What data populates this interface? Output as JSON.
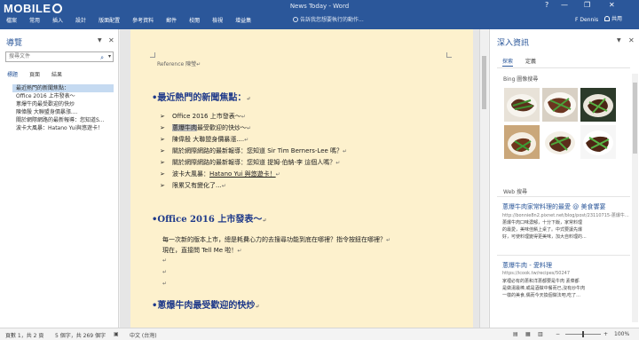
{
  "window": {
    "title": "News Today - Word",
    "logo_text": "MOBILE",
    "logo_suffix": "01",
    "controls": [
      "?",
      "—",
      "❐",
      "✕"
    ]
  },
  "ribbon": {
    "tabs": [
      "檔案",
      "常用",
      "插入",
      "設計",
      "版面配置",
      "參考資料",
      "郵件",
      "校閱",
      "檢視",
      "增益集"
    ],
    "tell_me": "告訴我您想要執行的動作...",
    "user": "F Dennis",
    "share": "共用"
  },
  "nav_pane": {
    "title": "導覽",
    "search_placeholder": "搜尋文件",
    "tabs": [
      "標題",
      "頁面",
      "結果"
    ],
    "items": [
      "最近熱門的新聞焦點：",
      "Office 2016 上市發表～",
      "蔥爆牛肉最受歡迎的快炒",
      "陳偉殷 大聯盟身價暴漲....",
      "關於網際網路的最新報導：您知道S...",
      "波卡大風暴：Hatano Yui與悠遊卡！"
    ]
  },
  "document": {
    "reference": "Reference 陳瑩",
    "heading1": "•最近熱門的新聞焦點：",
    "bullets": [
      {
        "pre": "Office 2016 上市發表～",
        "hl": "",
        "post": ""
      },
      {
        "pre": "",
        "hl": "蔥爆牛肉",
        "post": "最受歡迎的快炒～"
      },
      {
        "pre": "陳偉殷 大聯盟身價暴漲....",
        "hl": "",
        "post": ""
      },
      {
        "pre": "關於網際網路的最新報導：您知道 Sir Tim Berners-Lee 嗎？",
        "hl": "",
        "post": ""
      },
      {
        "pre": "關於網際網路的最新報導：您知道 提姆·伯納-李 這個人嗎？",
        "hl": "",
        "post": ""
      },
      {
        "pre": "波卡大風暴：",
        "hl": "",
        "post": "Hatano Yui 與悠遊卡！"
      },
      {
        "pre": "限累又有變化了...",
        "hl": "",
        "post": ""
      }
    ],
    "heading2": "•Office 2016 上市發表～",
    "para1": "每一次新的版本上市，總是耗費心力的去搜尋功能到底在哪裡？指令按鈕在哪裡？",
    "para2": "現在，直接問 Tell Me 啦！",
    "heading3": "•蔥爆牛肉最受歡迎的快炒"
  },
  "insights": {
    "title": "深入資訊",
    "tabs": [
      "探索",
      "定義"
    ],
    "image_section": "Bing 圖像搜尋",
    "web_section": "Web 搜尋",
    "results": [
      {
        "link": "蔥爆牛肉家常料理的最愛 @ 美食饗宴",
        "url": "http://bonnie8n2.pixnet.net/blog/post/23110715-蔥爆牛...",
        "desc": [
          "蔥爆牛肉口味濃郁，十分下飯，家常料理",
          "的最愛，美味佳餚上桌了。中式要讓先爆",
          "好，可使料理變得更美味，加大自料理的..."
        ]
      },
      {
        "link": "蔥爆牛肉 - 愛料理",
        "url": "https://icook.tw/recipes/50247",
        "desc": [
          "家裡必有的蔥和洋蔥都要是牛肉 素菜都",
          "是做湯最棒,或是酒做中餐而已,沒有炒牛肉",
          "一樣的美食,偶而今天換個做法吧,吃了..."
        ]
      }
    ]
  },
  "status": {
    "page": "頁數 1，共 2 頁",
    "words": "5 個字，共 269 個字",
    "lang": "中文 (台灣)",
    "zoom": "100%"
  },
  "colors": {
    "ribbon": "#2b579a",
    "page": "#fdf1cd",
    "heading": "#1f3a8a"
  }
}
